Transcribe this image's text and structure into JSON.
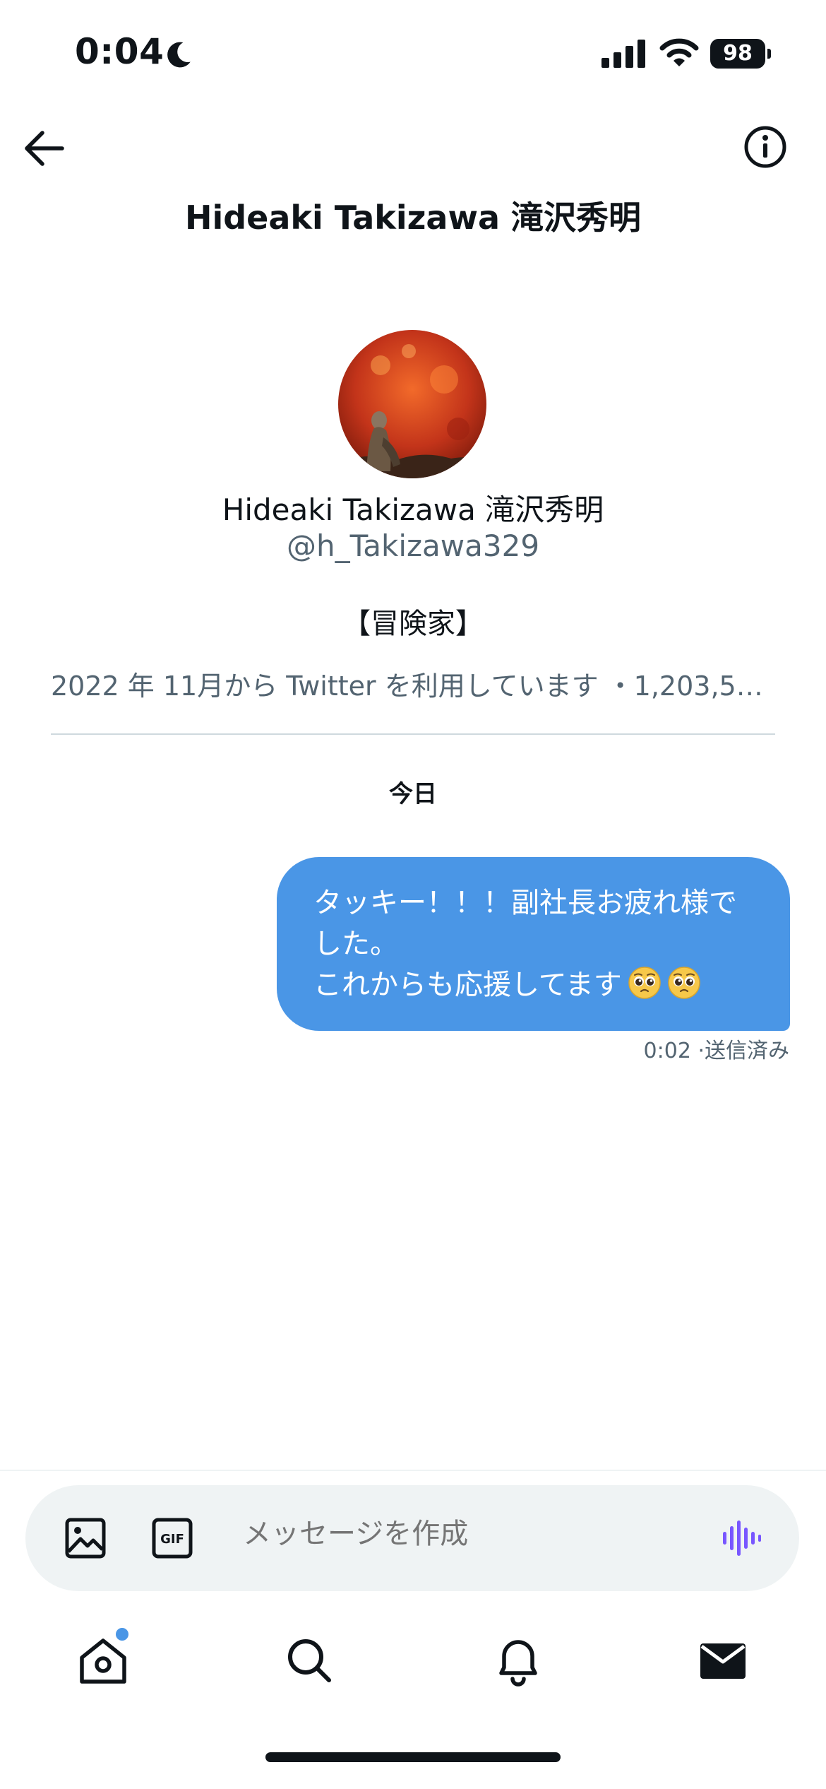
{
  "status_bar": {
    "time": "0:04",
    "battery": "98",
    "icons": [
      "moon-icon",
      "signal-icon",
      "wifi-icon",
      "battery-icon"
    ]
  },
  "header": {
    "title": "Hideaki Takizawa 滝沢秀明",
    "back_icon": "arrow-left-icon",
    "info_icon": "info-icon"
  },
  "profile": {
    "name": "Hideaki Takizawa 滝沢秀明",
    "handle": "@h_Takizawa329",
    "bio": "【冒険家】",
    "meta": "2022 年 11月から Twitter を利用しています ・1,203,52..."
  },
  "conversation": {
    "date_label": "今日",
    "messages": [
      {
        "lines": [
          "タッキー！！！副社長お疲れ様で",
          "した。",
          "これからも応援してます"
        ],
        "emoji": [
          "pleading-face-emoji",
          "pleading-face-emoji"
        ],
        "time": "0:02",
        "status": "·送信済み"
      }
    ]
  },
  "composer": {
    "placeholder": "メッセージを作成",
    "image_icon": "image-icon",
    "gif_icon": "gif-icon",
    "voice_icon": "voice-wave-icon",
    "accent_color": "#7856ff"
  },
  "bottom_nav": {
    "items": [
      "home-icon",
      "search-icon",
      "bell-icon",
      "mail-icon"
    ],
    "badge_color": "#4a96e6"
  },
  "colors": {
    "bubble": "#4a96e6",
    "secondary_text": "#536471",
    "primary_text": "#0f1419"
  }
}
